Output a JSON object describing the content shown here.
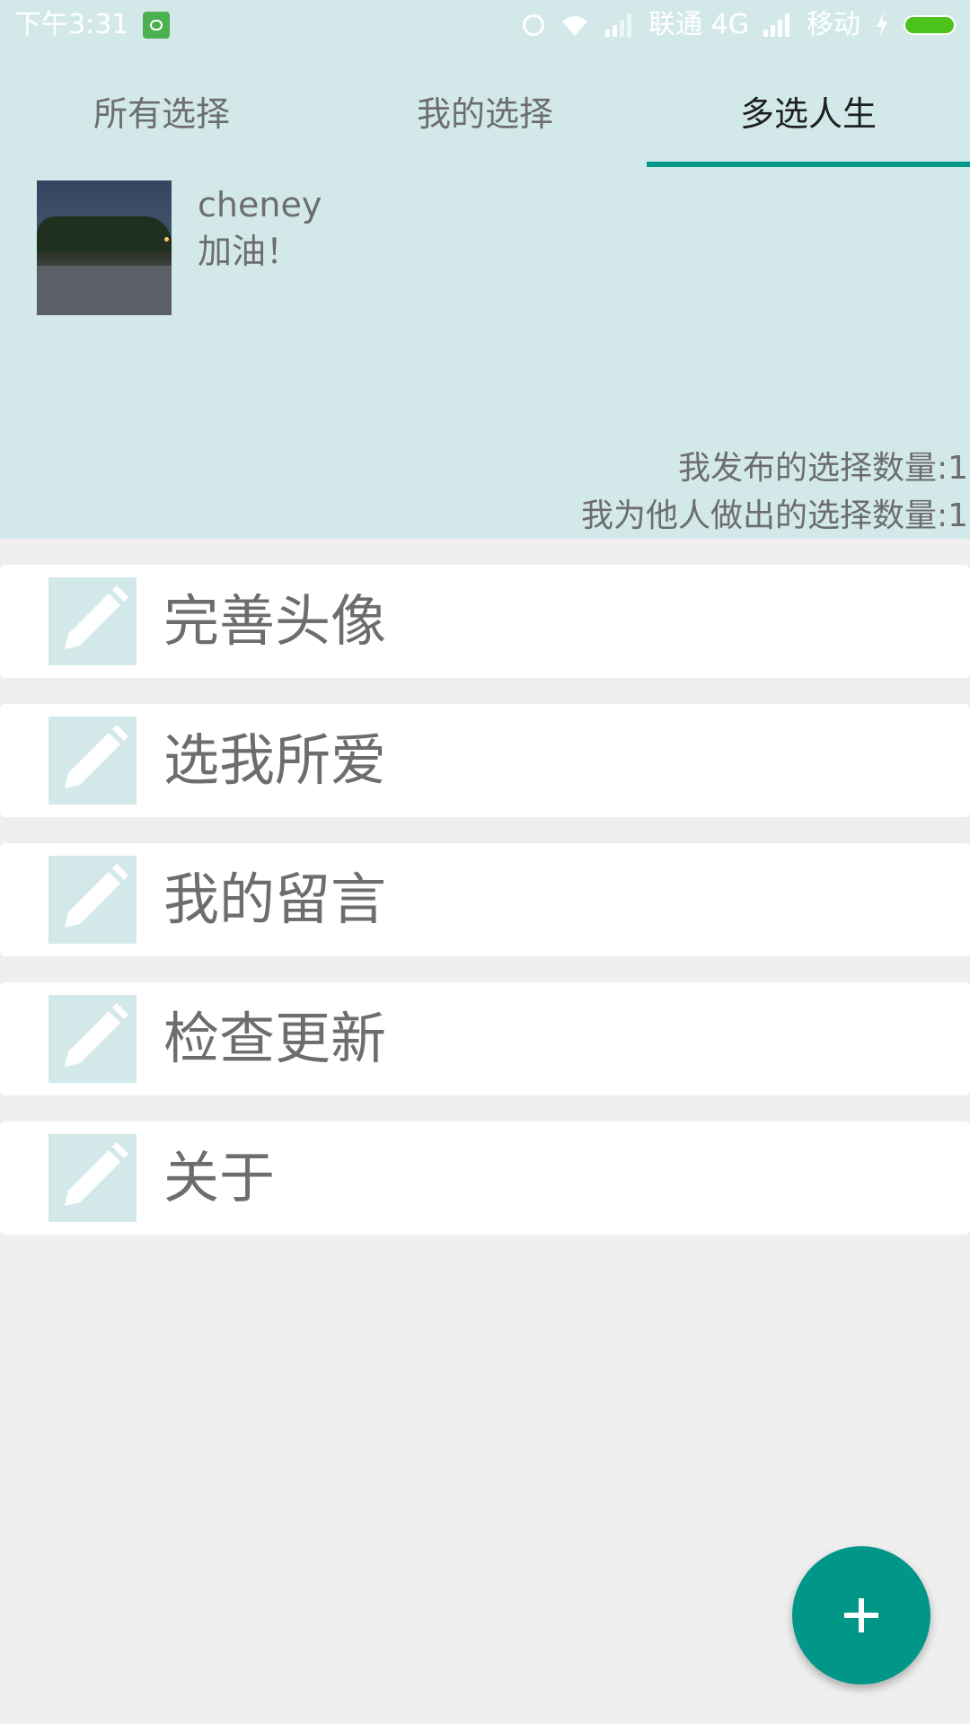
{
  "status_bar": {
    "time": "下午3:31",
    "carrier1": "联通 4G",
    "carrier2": "移动",
    "icons": [
      "app-notification-icon",
      "alarm-icon",
      "wifi-icon",
      "signal-icon",
      "bolt-icon",
      "battery-icon"
    ]
  },
  "tabs": [
    {
      "label": "所有选择",
      "active": false
    },
    {
      "label": "我的选择",
      "active": false
    },
    {
      "label": "多选人生",
      "active": true
    }
  ],
  "profile": {
    "username": "cheney",
    "motto": "加油！",
    "published_count": "我发布的选择数量:1",
    "chosen_for_others_count": "我为他人做出的选择数量:1"
  },
  "menu": [
    {
      "label": "完善头像",
      "icon": "pencil-icon"
    },
    {
      "label": "选我所爱",
      "icon": "pencil-icon"
    },
    {
      "label": "我的留言",
      "icon": "pencil-icon"
    },
    {
      "label": "检查更新",
      "icon": "pencil-icon"
    },
    {
      "label": "关于",
      "icon": "pencil-icon"
    }
  ],
  "fab": {
    "icon": "plus-icon"
  },
  "colors": {
    "header_bg": "#d3e9e9",
    "accent": "#009688",
    "page_bg": "#efefef",
    "text_gray": "#6d6d6d"
  }
}
